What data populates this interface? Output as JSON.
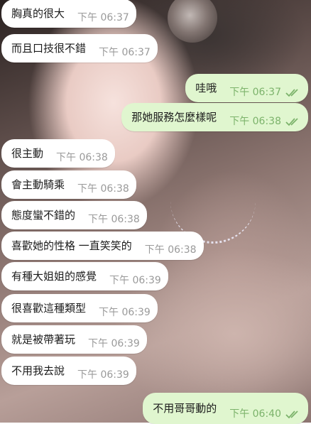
{
  "messages": [
    {
      "dir": "in",
      "text": "胸真的很大",
      "time": "下午 06:37"
    },
    {
      "dir": "in",
      "text": "而且口技很不錯",
      "time": "下午 06:37"
    },
    {
      "dir": "out",
      "text": "哇哦",
      "time": "下午 06:37",
      "read": true
    },
    {
      "dir": "out",
      "text": "那她服務怎麼樣呢",
      "time": "下午 06:38",
      "read": true
    },
    {
      "dir": "in",
      "text": "很主動",
      "time": "下午 06:38"
    },
    {
      "dir": "in",
      "text": "會主動騎乘",
      "time": "下午 06:38"
    },
    {
      "dir": "in",
      "text": "態度蠻不錯的",
      "time": "下午 06:38"
    },
    {
      "dir": "in",
      "text": "喜歡她的性格 一直笑笑的",
      "time": "下午 06:38"
    },
    {
      "dir": "in",
      "text": "有種大姐姐的感覺",
      "time": "下午 06:39"
    },
    {
      "dir": "in",
      "text": "很喜歡這種類型",
      "time": "下午 06:39"
    },
    {
      "dir": "in",
      "text": "就是被帶著玩",
      "time": "下午 06:39"
    },
    {
      "dir": "in",
      "text": "不用我去說",
      "time": "下午 06:39"
    },
    {
      "dir": "out",
      "text": "不用哥哥動的",
      "time": "下午 06:40",
      "read": true
    }
  ],
  "colors": {
    "incoming_bubble": "#ffffff",
    "outgoing_bubble": "#e0f6cf",
    "outgoing_time": "#7cb36b",
    "incoming_time": "#9a9a9a"
  },
  "icons": {
    "read_receipt": "double-check-icon"
  }
}
